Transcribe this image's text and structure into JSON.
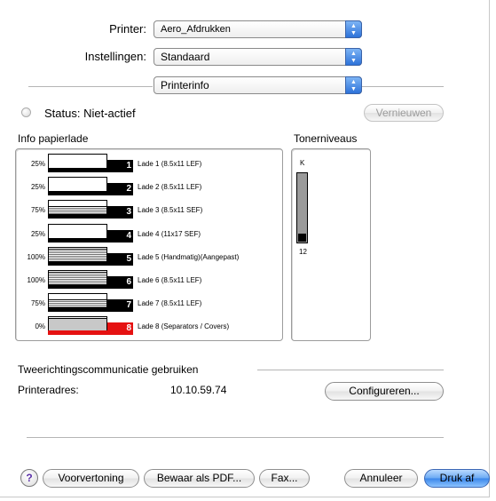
{
  "top": {
    "printer_label": "Printer:",
    "printer_value": "Aero_Afdrukken",
    "settings_label": "Instellingen:",
    "settings_value": "Standaard",
    "panel_value": "Printerinfo"
  },
  "status": {
    "text": "Status: Niet-actief",
    "refresh_label": "Vernieuwen"
  },
  "trays": {
    "title": "Info papierlade",
    "items": [
      {
        "percent": "25%",
        "number": "1",
        "name": "Lade 1 (8.5x11 LEF)",
        "level": 0.25,
        "color": "#000000"
      },
      {
        "percent": "25%",
        "number": "2",
        "name": "Lade 2 (8.5x11 LEF)",
        "level": 0.25,
        "color": "#000000"
      },
      {
        "percent": "75%",
        "number": "3",
        "name": "Lade 3 (8.5x11 SEF)",
        "level": 0.75,
        "color": "#000000"
      },
      {
        "percent": "25%",
        "number": "4",
        "name": "Lade 4 (11x17 SEF)",
        "level": 0.25,
        "color": "#000000"
      },
      {
        "percent": "100%",
        "number": "5",
        "name": "Lade 5 (Handmatig)(Aangepast)",
        "level": 1.0,
        "color": "#000000"
      },
      {
        "percent": "100%",
        "number": "6",
        "name": "Lade 6 (8.5x11 LEF)",
        "level": 1.0,
        "color": "#000000"
      },
      {
        "percent": "75%",
        "number": "7",
        "name": "Lade 7 (8.5x11 LEF)",
        "level": 0.75,
        "color": "#000000"
      },
      {
        "percent": "0%",
        "number": "8",
        "name": "Lade 8 (Separators / Covers)",
        "level": 0.0,
        "color": "#e51111"
      }
    ]
  },
  "toner": {
    "title": "Tonerniveaus",
    "label": "K",
    "value": "12",
    "level": 0.12
  },
  "comm": {
    "title": "Tweerichtingscommunicatie gebruiken",
    "address_label": "Printeradres:",
    "address_value": "10.10.59.74",
    "configure_label": "Configureren..."
  },
  "footer": {
    "help_label": "?",
    "preview_label": "Voorvertoning",
    "pdf_label": "Bewaar als PDF...",
    "fax_label": "Fax...",
    "cancel_label": "Annuleer",
    "print_label": "Druk af"
  },
  "colors": {
    "accent": "#3a86ea",
    "empty_tray": "#e51111"
  }
}
